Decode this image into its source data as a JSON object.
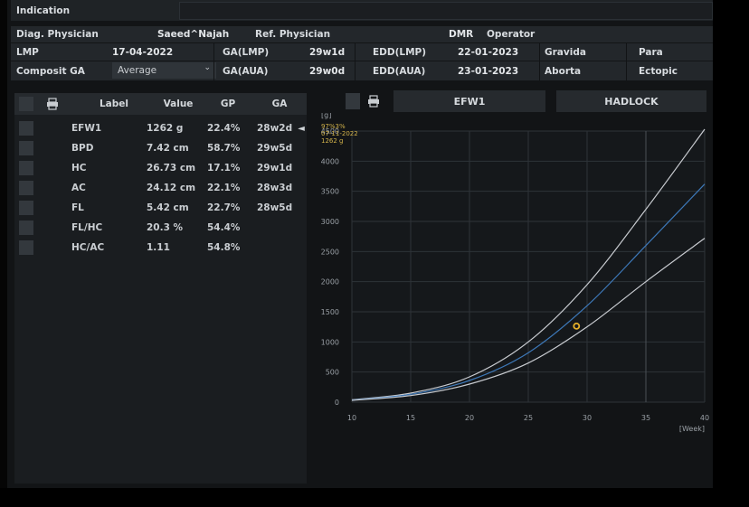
{
  "header": {
    "indication_label": "Indication",
    "indication_value": "",
    "diag_physician_label": "Diag. Physician",
    "diag_physician_value": "Saeed^Najah",
    "ref_physician_label": "Ref. Physician",
    "ref_physician_value": "DMR",
    "operator_label": "Operator",
    "operator_value": "",
    "lmp_label": "LMP",
    "lmp_value": "17-04-2022",
    "ga_lmp_label": "GA(LMP)",
    "ga_lmp_value": "29w1d",
    "edd_lmp_label": "EDD(LMP)",
    "edd_lmp_value": "22-01-2023",
    "gravida_label": "Gravida",
    "para_label": "Para",
    "composit_ga_label": "Composit GA",
    "composit_ga_select": "Average",
    "ga_aua_label": "GA(AUA)",
    "ga_aua_value": "29w0d",
    "edd_aua_label": "EDD(AUA)",
    "edd_aua_value": "23-01-2023",
    "aborta_label": "Aborta",
    "ectopic_label": "Ectopic"
  },
  "table": {
    "columns": [
      "Label",
      "Value",
      "GP",
      "GA"
    ],
    "rows": [
      {
        "label": "EFW1",
        "value": "1262 g",
        "gp": "22.4%",
        "ga": "28w2d",
        "selected": true
      },
      {
        "label": "BPD",
        "value": "7.42 cm",
        "gp": "58.7%",
        "ga": "29w5d"
      },
      {
        "label": "HC",
        "value": "26.73 cm",
        "gp": "17.1%",
        "ga": "29w1d"
      },
      {
        "label": "AC",
        "value": "24.12 cm",
        "gp": "22.1%",
        "ga": "28w3d"
      },
      {
        "label": "FL",
        "value": "5.42 cm",
        "gp": "22.7%",
        "ga": "28w5d"
      },
      {
        "label": "FL/HC",
        "value": "20.3 %",
        "gp": "54.4%",
        "ga": ""
      },
      {
        "label": "HC/AC",
        "value": "1.11",
        "gp": "54.8%",
        "ga": ""
      }
    ]
  },
  "chart_panel": {
    "measure_button": "EFW1",
    "method_button": "HADLOCK"
  },
  "chart_data": {
    "type": "line",
    "ylabel": "[g]",
    "xlabel": "[Week]",
    "xlim": [
      10,
      40
    ],
    "ylim": [
      0,
      4500
    ],
    "xticks": [
      10,
      15,
      20,
      25,
      30,
      35,
      40
    ],
    "yticks": [
      0,
      500,
      1000,
      1500,
      2000,
      2500,
      3000,
      3500,
      4000,
      4500
    ],
    "grid": true,
    "annotation_lines": [
      "97%3%",
      "07-11-2022",
      "1262 g"
    ],
    "current_marker_week": 35,
    "series": [
      {
        "name": "97%",
        "color": "#c8cbd0",
        "x": [
          10,
          15,
          20,
          25,
          30,
          35,
          40
        ],
        "values": [
          40,
          150,
          420,
          1000,
          1950,
          3200,
          4530
        ]
      },
      {
        "name": "50%",
        "color": "#3d78b8",
        "x": [
          10,
          15,
          20,
          25,
          30,
          35,
          40
        ],
        "values": [
          35,
          130,
          360,
          820,
          1600,
          2600,
          3620
        ]
      },
      {
        "name": "3%",
        "color": "#c8cbd0",
        "x": [
          10,
          15,
          20,
          25,
          30,
          35,
          40
        ],
        "values": [
          30,
          110,
          300,
          650,
          1250,
          2000,
          2720
        ]
      }
    ],
    "points": [
      {
        "x": 29.1,
        "y": 1262,
        "color": "#e5b02a"
      }
    ]
  },
  "colors": {
    "accent_point": "#e5b02a",
    "median_curve": "#3d78b8",
    "percentile_curves": "#c8cbd0",
    "annotation_text": "#d2b24a"
  }
}
